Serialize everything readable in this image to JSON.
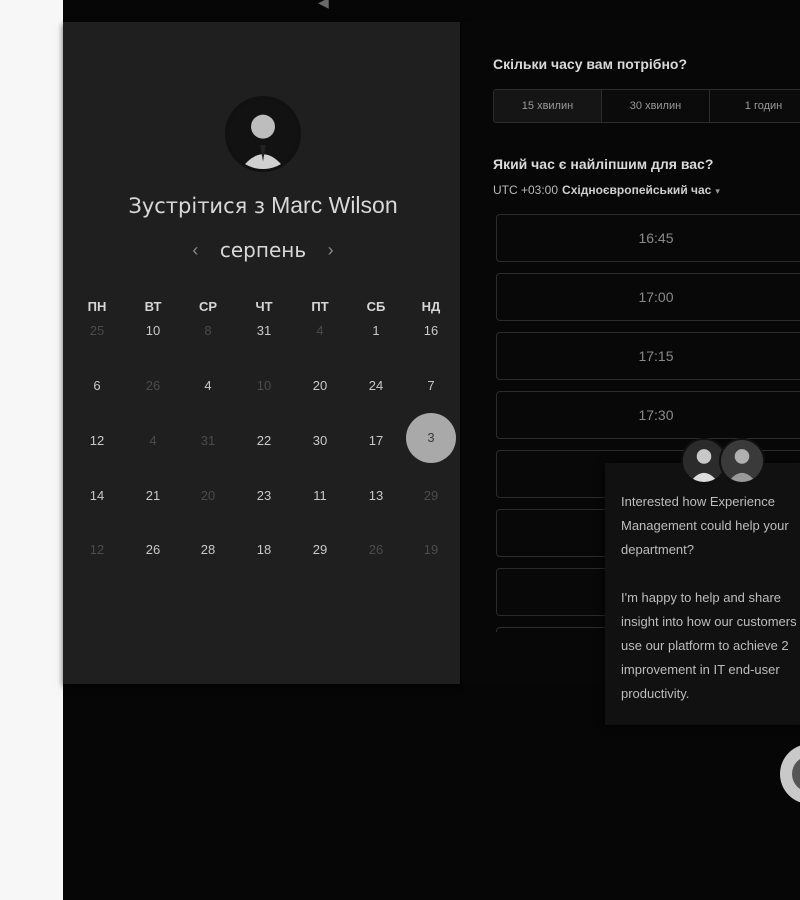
{
  "meeting": {
    "prefix": "Зустрітися з",
    "host_name": "Marc Wilson"
  },
  "calendar": {
    "month": "серпень",
    "prev_arrow": "‹",
    "next_arrow": "›",
    "weekdays": [
      "ПН",
      "ВТ",
      "СР",
      "ЧТ",
      "ПТ",
      "СБ",
      "НД"
    ],
    "weeks": [
      [
        {
          "d": "25",
          "m": true
        },
        {
          "d": "10",
          "m": false
        },
        {
          "d": "8",
          "m": true
        },
        {
          "d": "31",
          "m": false
        },
        {
          "d": "4",
          "m": true
        },
        {
          "d": "1",
          "m": false
        },
        {
          "d": "16",
          "m": false
        }
      ],
      [
        {
          "d": "6",
          "m": false
        },
        {
          "d": "26",
          "m": true
        },
        {
          "d": "4",
          "m": false
        },
        {
          "d": "10",
          "m": true
        },
        {
          "d": "20",
          "m": false
        },
        {
          "d": "24",
          "m": false
        },
        {
          "d": "7",
          "m": false
        }
      ],
      [
        {
          "d": "12",
          "m": false
        },
        {
          "d": "4",
          "m": true
        },
        {
          "d": "31",
          "m": true
        },
        {
          "d": "22",
          "m": false
        },
        {
          "d": "30",
          "m": false
        },
        {
          "d": "17",
          "m": false
        },
        {
          "d": "3",
          "m": false,
          "selected": true
        }
      ],
      [
        {
          "d": "14",
          "m": false
        },
        {
          "d": "21",
          "m": false
        },
        {
          "d": "20",
          "m": true
        },
        {
          "d": "23",
          "m": false
        },
        {
          "d": "11",
          "m": false
        },
        {
          "d": "13",
          "m": false
        },
        {
          "d": "29",
          "m": true
        }
      ],
      [
        {
          "d": "12",
          "m": true
        },
        {
          "d": "26",
          "m": false
        },
        {
          "d": "28",
          "m": false
        },
        {
          "d": "18",
          "m": false
        },
        {
          "d": "29",
          "m": false
        },
        {
          "d": "26",
          "m": true
        },
        {
          "d": "19",
          "m": true
        }
      ]
    ]
  },
  "duration": {
    "question": "Скільки часу вам потрібно?",
    "options": [
      "15 хвилин",
      "30 хвилин",
      "1 годин"
    ]
  },
  "time": {
    "question": "Який час є найліпшим для вас?",
    "tz_offset": "UTC +03:00",
    "tz_name": "Східноєвропейський час",
    "tz_caret": "▾",
    "slots": [
      "16:45",
      "17:00",
      "17:15",
      "17:30",
      "",
      "",
      "",
      ""
    ]
  },
  "chat": {
    "line1": "Interested how Experience",
    "line2": "Management could help your",
    "line3": "department?",
    "line4": "I'm happy to help and share",
    "line5": "insight into how our customers",
    "line6": "use our platform to achieve 2",
    "line7": "improvement in IT end-user",
    "line8": "productivity."
  },
  "colors": {
    "accent_selected": "#a9a9a9",
    "panel_bg": "#1f1f1f",
    "backdrop": "#060606"
  }
}
